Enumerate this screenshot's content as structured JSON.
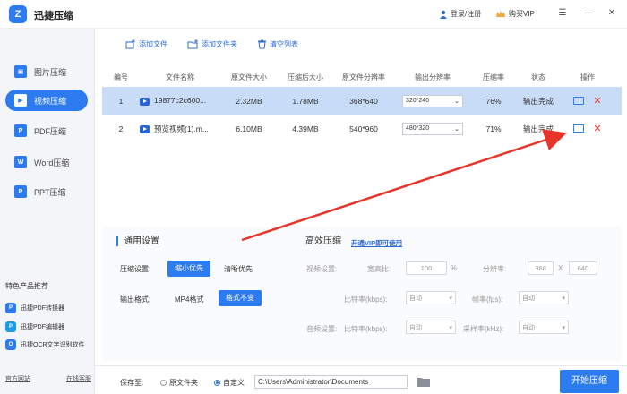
{
  "app": {
    "title": "迅捷压缩",
    "logo_glyph": "Z"
  },
  "header": {
    "login": "登录/注册",
    "vip": "购买VIP"
  },
  "sidebar": {
    "items": [
      {
        "label": "图片压缩",
        "icon": "image-icon",
        "color": "#2d7bf0"
      },
      {
        "label": "视频压缩",
        "icon": "video-icon",
        "color": "#2d7bf0"
      },
      {
        "label": "PDF压缩",
        "icon": "pdf-icon",
        "color": "#2d7bf0"
      },
      {
        "label": "Word压缩",
        "icon": "word-icon",
        "color": "#2d7bf0"
      },
      {
        "label": "PPT压缩",
        "icon": "ppt-icon",
        "color": "#2d7bf0"
      }
    ],
    "active_index": 1,
    "recommend_title": "特色产品推荐",
    "recommend": [
      {
        "label": "迅捷PDF转换器",
        "color": "#2d7bf0"
      },
      {
        "label": "迅捷PDF编辑器",
        "color": "#1a9be8"
      },
      {
        "label": "迅捷OCR文字识别软件",
        "color": "#2d7bf0"
      }
    ],
    "footer": {
      "website": "官方网站",
      "support": "在线客服"
    }
  },
  "toolbar": {
    "add_file": "添加文件",
    "add_folder": "添加文件夹",
    "clear": "清空列表"
  },
  "table": {
    "headers": [
      "编号",
      "文件名称",
      "原文件大小",
      "压缩后大小",
      "原文件分辨率",
      "输出分辨率",
      "压缩率",
      "状态",
      "操作"
    ],
    "rows": [
      {
        "no": "1",
        "name": "19877c2c600...",
        "orig": "2.32MB",
        "after": "1.78MB",
        "res": "368*640",
        "out": "320*240",
        "ratio": "76%",
        "status": "输出完成"
      },
      {
        "no": "2",
        "name": "预览视频(1).m...",
        "orig": "6.10MB",
        "after": "4.39MB",
        "res": "540*960",
        "out": "480*320",
        "ratio": "71%",
        "status": "输出完成"
      }
    ]
  },
  "general": {
    "title": "通用设置",
    "level_label": "压缩设置:",
    "level_small": "缩小优先",
    "level_clear": "清晰优先",
    "format_label": "输出格式:",
    "format_mp4": "MP4格式",
    "format_keep": "格式不变"
  },
  "advanced": {
    "title": "高效压缩",
    "vip_link": "开通VIP即可使用",
    "video_label": "视频设置:",
    "aspect_label": "宽高比:",
    "aspect_value": "100",
    "pct": "%",
    "resolution_label": "分辨率:",
    "res_w": "368",
    "x": "X",
    "res_h": "640",
    "bitrate_label": "比特率(kbps):",
    "bitrate_value": "自动",
    "fps_label": "帧率(fps):",
    "fps_value": "自动",
    "audio_label": "音频设置:",
    "abitrate_label": "比特率(kbps):",
    "abitrate_value": "自动",
    "sample_label": "采样率(kHz):",
    "sample_value": "自动"
  },
  "bottom": {
    "save_label": "保存至:",
    "opt_orig": "原文件夹",
    "opt_custom": "自定义",
    "path": "C:\\Users\\Administrator\\Documents",
    "start": "开始压缩"
  },
  "colors": {
    "accent": "#2d7bf0",
    "selected_row": "#c9dcf7",
    "arrow": "#e8332b"
  }
}
